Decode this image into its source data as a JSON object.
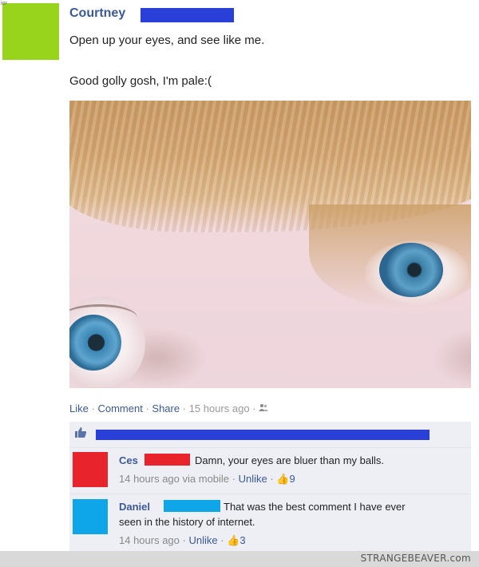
{
  "post": {
    "author": "Courtney",
    "line1": "Open up your eyes, and see like me.",
    "line2": "Good golly gosh, I'm pale:(",
    "corner_text": "ior"
  },
  "actions": {
    "like": "Like",
    "comment": "Comment",
    "share": "Share",
    "time": "15 hours ago",
    "sep": "·"
  },
  "comments": [
    {
      "author": "Ces",
      "text": "Damn, your eyes are bluer than my balls.",
      "time": "14 hours ago via mobile",
      "unlike": "Unlike",
      "likes": "9"
    },
    {
      "author": "Daniel",
      "text_line1": "That was the best comment I have ever",
      "text_line2": "seen in the history of internet.",
      "time": "14 hours ago",
      "unlike": "Unlike",
      "likes": "3"
    }
  ],
  "footer": {
    "watermark": "STRANGEBEAVER.com"
  },
  "colors": {
    "link": "#3b5998",
    "redact_blue_dark": "#2a3ed8",
    "redact_red": "#e8232b",
    "redact_blue_light": "#0ea5e9",
    "main_avatar": "#99d41c"
  }
}
